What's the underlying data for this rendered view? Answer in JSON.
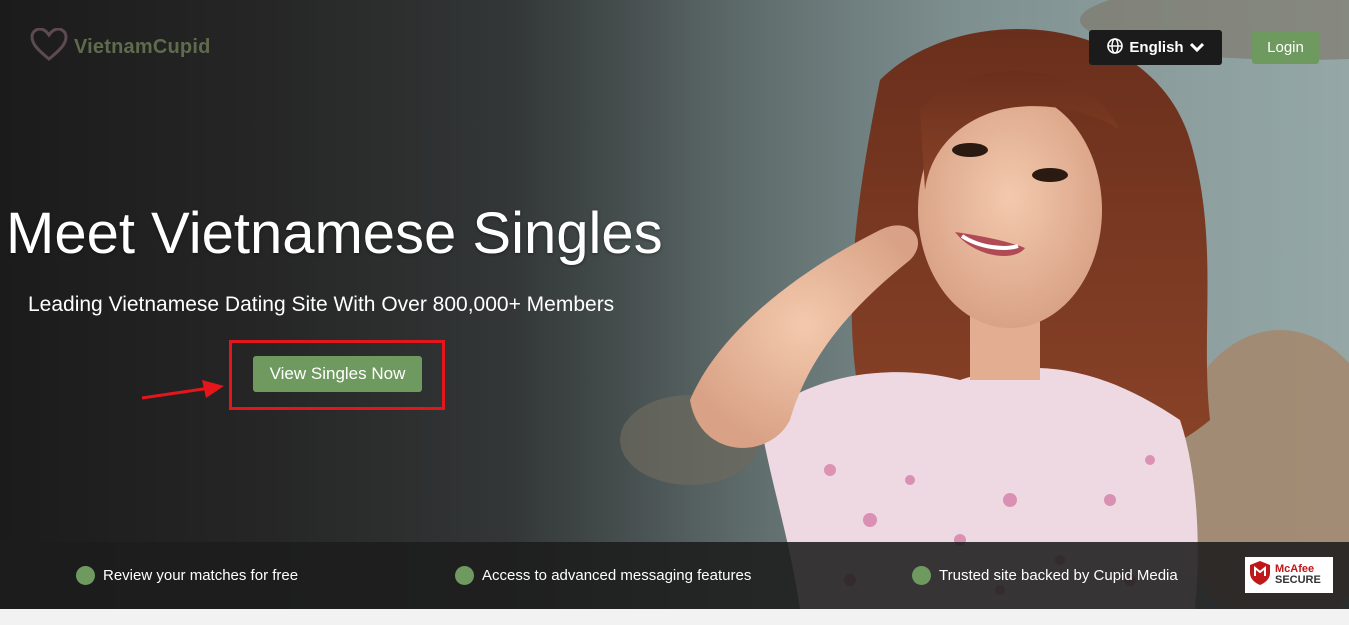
{
  "brand": {
    "name": "VietnamCupid",
    "logo_icon": "heart-icon"
  },
  "header": {
    "language_label": "English",
    "language_icon": "globe-icon",
    "language_chevron": "chevron-down-icon",
    "login_label": "Login"
  },
  "hero": {
    "title": "Meet Vietnamese Singles",
    "subtitle": "Leading Vietnamese Dating Site With Over 800,000+ Members",
    "cta_label": "View Singles Now"
  },
  "features": [
    {
      "label": "Review your matches for free"
    },
    {
      "label": "Access to advanced messaging features"
    },
    {
      "label": "Trusted site backed by Cupid Media"
    }
  ],
  "badge": {
    "brand": "McAfee",
    "label": "SECURE"
  },
  "colors": {
    "accent": "#6e9a5f",
    "highlight": "#e5161b",
    "dark": "#1b1b1b"
  }
}
